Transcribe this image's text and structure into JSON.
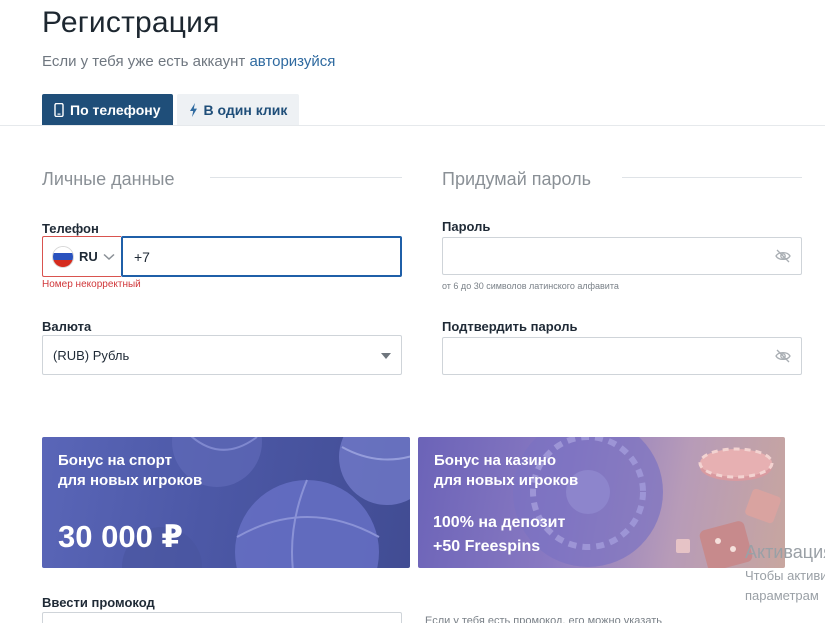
{
  "header": {
    "title": "Регистрация",
    "subtitle": "Если у тебя уже есть аккаунт",
    "login_link": "авторизуйся"
  },
  "tabs": [
    {
      "label": "По телефону",
      "active": true,
      "icon": "phone-icon"
    },
    {
      "label": "В один клик",
      "active": false,
      "icon": "lightning-icon"
    }
  ],
  "personal": {
    "section_title": "Личные данные",
    "phone_label": "Телефон",
    "country_code": "RU",
    "phone_value": "+7",
    "phone_error": "Номер некорректный",
    "currency_label": "Валюта",
    "currency_value": "(RUB) Рубль"
  },
  "password": {
    "section_title": "Придумай пароль",
    "password_label": "Пароль",
    "password_value": "",
    "password_hint": "от 6 до 30 символов латинского алфавита",
    "confirm_label": "Подтвердить пароль",
    "confirm_value": ""
  },
  "banners": {
    "sport": {
      "title_line1": "Бонус на спорт",
      "title_line2": "для новых игроков",
      "amount": "30 000 ₽"
    },
    "casino": {
      "title_line1": "Бонус на казино",
      "title_line2": "для новых игроков",
      "offer_line1": "100% на депозит",
      "offer_line2": "+50 Freespins"
    }
  },
  "promo": {
    "label": "Ввести промокод",
    "value": "",
    "hint": "Если у тебя есть промокод, его можно указать"
  },
  "watermark": {
    "line1": "Активация Windows",
    "line2": "Чтобы активировать Windows,",
    "line3": "параметрам"
  },
  "colors": {
    "accent": "#1f4e79",
    "link": "#2f6aa0",
    "error": "#d0373a",
    "focus_border": "#1f5fa8"
  }
}
